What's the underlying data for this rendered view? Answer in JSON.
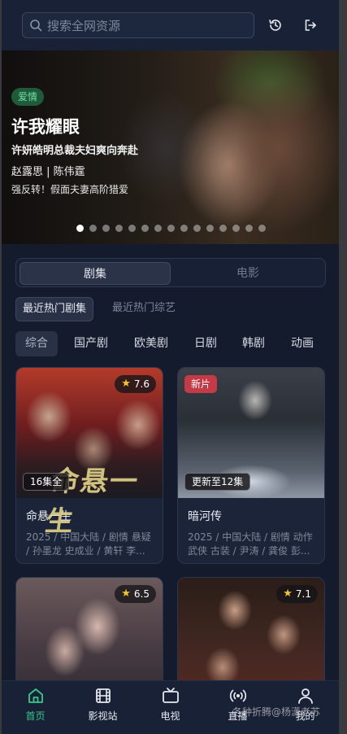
{
  "search": {
    "placeholder": "搜索全网资源",
    "icon": "search-icon"
  },
  "header": {
    "history_icon": "history-icon",
    "logout_icon": "logout-icon"
  },
  "banner": {
    "tag": "爱情",
    "title": "许我耀眼",
    "subtitle": "许妍皓明总裁夫妇爽向奔赴",
    "cast": "赵露思 | 陈伟霆",
    "description": "强反转！假面夫妻高阶猎爱",
    "slide_count": 15,
    "active_slide": 1
  },
  "segment": {
    "items": [
      "剧集",
      "电影"
    ],
    "active": "剧集"
  },
  "subtabs": {
    "items": [
      "最近热门剧集",
      "最近热门综艺"
    ],
    "active": "最近热门剧集"
  },
  "categories": {
    "items": [
      "综合",
      "国产剧",
      "欧美剧",
      "日剧",
      "韩剧",
      "动画"
    ],
    "active": "综合"
  },
  "cards": [
    {
      "title": "命悬一生",
      "rating": "7.6",
      "episodes": "16集全",
      "poster_text": "命悬一生",
      "meta1": "2025 / 中国大陆 / 剧情 悬疑",
      "meta2": "/ 孙墨龙 史成业 / 黄轩 李..."
    },
    {
      "title": "暗河传",
      "badge": "新片",
      "episodes": "更新至12集",
      "meta1": "2025 / 中国大陆 / 剧情 动作",
      "meta2": "武侠 古装 / 尹涛 / 龚俊 彭..."
    },
    {
      "rating": "6.5"
    },
    {
      "rating": "7.1"
    }
  ],
  "nav": {
    "items": [
      {
        "label": "首页",
        "icon": "home-icon"
      },
      {
        "label": "影视站",
        "icon": "film-icon"
      },
      {
        "label": "电视",
        "icon": "tv-icon"
      },
      {
        "label": "直播",
        "icon": "broadcast-icon"
      },
      {
        "label": "我的",
        "icon": "user-icon"
      }
    ],
    "active": "首页"
  },
  "watermark": "各种折腾@杨潇老苏",
  "colors": {
    "accent": "#38c98a",
    "background": "#131b2d",
    "badge_red": "#c53a47",
    "star": "#f6c42b"
  }
}
